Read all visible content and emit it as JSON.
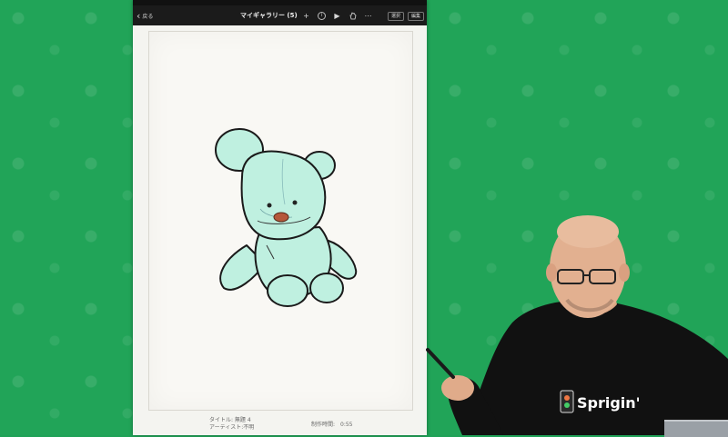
{
  "toolbar": {
    "back_label": "戻る",
    "gallery_title": "マイギャラリー (5)",
    "select_label": "選択",
    "edit_label": "編集"
  },
  "artwork_info": {
    "title_line": "タイトル: 無題 4",
    "artist_line": "アーティスト:不明",
    "time_line": "制作時間:　0:55"
  },
  "presenter": {
    "shirt_logo": "Sprigin'"
  },
  "colors": {
    "background_green": "#21a458",
    "toolbar": "#1b1b1b",
    "canvas": "#f9f8f4",
    "bear_fill": "#bff0e0",
    "nose": "#b5583a"
  },
  "icons": [
    "chevron-left-icon",
    "plus-icon",
    "info-icon",
    "play-icon",
    "hand-icon",
    "more-icon"
  ]
}
